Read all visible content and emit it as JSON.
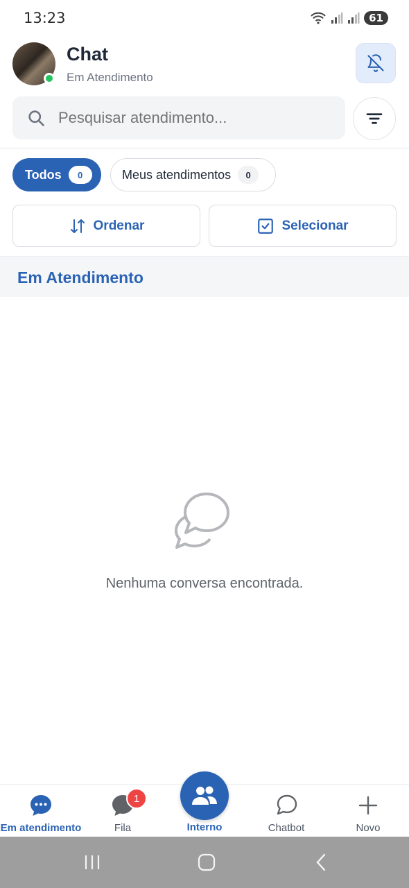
{
  "status_bar": {
    "time": "13:23",
    "battery": "61"
  },
  "header": {
    "title": "Chat",
    "subtitle": "Em Atendimento"
  },
  "search": {
    "placeholder": "Pesquisar atendimento..."
  },
  "tabs": [
    {
      "label": "Todos",
      "count": "0",
      "active": true
    },
    {
      "label": "Meus atendimentos",
      "count": "0",
      "active": false
    }
  ],
  "actions": {
    "order_label": "Ordenar",
    "select_label": "Selecionar"
  },
  "section": {
    "title": "Em Atendimento"
  },
  "empty_state": {
    "message": "Nenhuma conversa encontrada."
  },
  "bottom_nav": {
    "items": [
      {
        "label": "Em atendimento",
        "icon": "chat-dots-icon",
        "active": true
      },
      {
        "label": "Fila",
        "icon": "chat-bubble-icon",
        "badge": "1"
      },
      {
        "label": "Interno",
        "icon": "users-icon"
      },
      {
        "label": "Chatbot",
        "icon": "chat-outline-icon"
      },
      {
        "label": "Novo",
        "icon": "plus-icon"
      }
    ]
  },
  "colors": {
    "accent": "#2b63b4",
    "online": "#22c55e",
    "badge": "#ef4444"
  }
}
